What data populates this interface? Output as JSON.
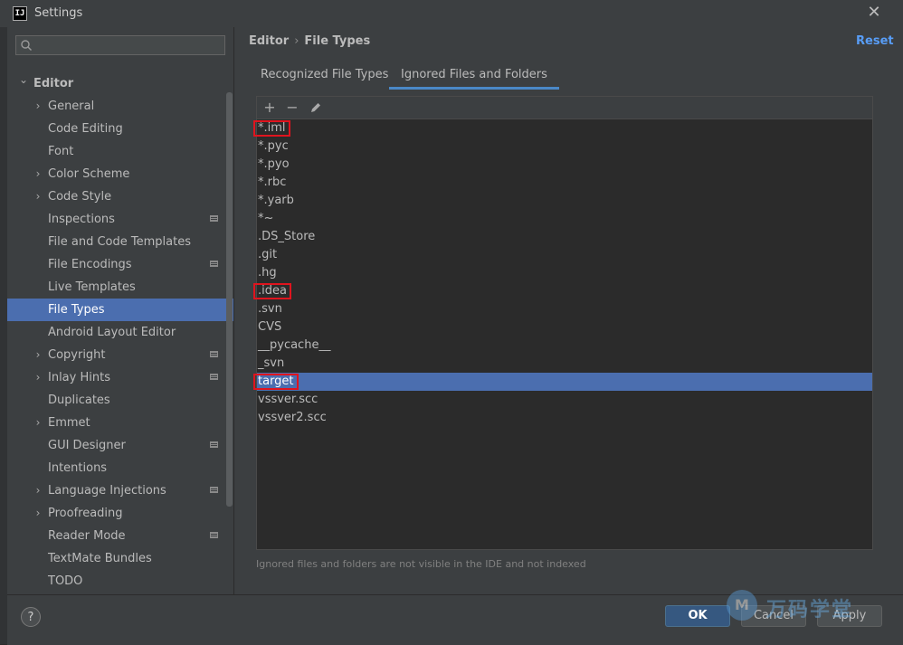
{
  "window": {
    "title": "Settings",
    "app_icon_text": "IJ"
  },
  "search": {
    "placeholder": ""
  },
  "sidebar": {
    "items": [
      {
        "label": "Editor",
        "level": 0,
        "expandable": true,
        "expanded": true,
        "selected": false,
        "badge": false
      },
      {
        "label": "General",
        "level": 1,
        "expandable": true,
        "selected": false,
        "badge": false
      },
      {
        "label": "Code Editing",
        "level": 1,
        "expandable": false,
        "selected": false,
        "badge": false
      },
      {
        "label": "Font",
        "level": 1,
        "expandable": false,
        "selected": false,
        "badge": false
      },
      {
        "label": "Color Scheme",
        "level": 1,
        "expandable": true,
        "selected": false,
        "badge": false
      },
      {
        "label": "Code Style",
        "level": 1,
        "expandable": true,
        "selected": false,
        "badge": false
      },
      {
        "label": "Inspections",
        "level": 1,
        "expandable": false,
        "selected": false,
        "badge": true
      },
      {
        "label": "File and Code Templates",
        "level": 1,
        "expandable": false,
        "selected": false,
        "badge": false
      },
      {
        "label": "File Encodings",
        "level": 1,
        "expandable": false,
        "selected": false,
        "badge": true
      },
      {
        "label": "Live Templates",
        "level": 1,
        "expandable": false,
        "selected": false,
        "badge": false
      },
      {
        "label": "File Types",
        "level": 1,
        "expandable": false,
        "selected": true,
        "badge": false
      },
      {
        "label": "Android Layout Editor",
        "level": 1,
        "expandable": false,
        "selected": false,
        "badge": false
      },
      {
        "label": "Copyright",
        "level": 1,
        "expandable": true,
        "selected": false,
        "badge": true
      },
      {
        "label": "Inlay Hints",
        "level": 1,
        "expandable": true,
        "selected": false,
        "badge": true
      },
      {
        "label": "Duplicates",
        "level": 1,
        "expandable": false,
        "selected": false,
        "badge": false
      },
      {
        "label": "Emmet",
        "level": 1,
        "expandable": true,
        "selected": false,
        "badge": false
      },
      {
        "label": "GUI Designer",
        "level": 1,
        "expandable": false,
        "selected": false,
        "badge": true
      },
      {
        "label": "Intentions",
        "level": 1,
        "expandable": false,
        "selected": false,
        "badge": false
      },
      {
        "label": "Language Injections",
        "level": 1,
        "expandable": true,
        "selected": false,
        "badge": true
      },
      {
        "label": "Proofreading",
        "level": 1,
        "expandable": true,
        "selected": false,
        "badge": false
      },
      {
        "label": "Reader Mode",
        "level": 1,
        "expandable": false,
        "selected": false,
        "badge": true
      },
      {
        "label": "TextMate Bundles",
        "level": 1,
        "expandable": false,
        "selected": false,
        "badge": false
      },
      {
        "label": "TODO",
        "level": 1,
        "expandable": false,
        "selected": false,
        "badge": false
      }
    ]
  },
  "breadcrumb": {
    "parent": "Editor",
    "separator": "›",
    "current": "File Types"
  },
  "header": {
    "reset_label": "Reset"
  },
  "tabs": [
    {
      "label": "Recognized File Types",
      "active": false
    },
    {
      "label": "Ignored Files and Folders",
      "active": true
    }
  ],
  "toolbar": {
    "add": "+",
    "remove": "−"
  },
  "ignored_list": [
    {
      "text": "*.iml",
      "selected": false,
      "highlighted": true
    },
    {
      "text": "*.pyc",
      "selected": false,
      "highlighted": false
    },
    {
      "text": "*.pyo",
      "selected": false,
      "highlighted": false
    },
    {
      "text": "*.rbc",
      "selected": false,
      "highlighted": false
    },
    {
      "text": "*.yarb",
      "selected": false,
      "highlighted": false
    },
    {
      "text": "*~",
      "selected": false,
      "highlighted": false
    },
    {
      "text": ".DS_Store",
      "selected": false,
      "highlighted": false
    },
    {
      "text": ".git",
      "selected": false,
      "highlighted": false
    },
    {
      "text": ".hg",
      "selected": false,
      "highlighted": false
    },
    {
      "text": ".idea",
      "selected": false,
      "highlighted": true
    },
    {
      "text": ".svn",
      "selected": false,
      "highlighted": false
    },
    {
      "text": "CVS",
      "selected": false,
      "highlighted": false
    },
    {
      "text": "__pycache__",
      "selected": false,
      "highlighted": false
    },
    {
      "text": "_svn",
      "selected": false,
      "highlighted": false
    },
    {
      "text": "target",
      "selected": true,
      "highlighted": true
    },
    {
      "text": "vssver.scc",
      "selected": false,
      "highlighted": false
    },
    {
      "text": "vssver2.scc",
      "selected": false,
      "highlighted": false
    }
  ],
  "note": "Ignored files and folders are not visible in the IDE and not indexed",
  "footer": {
    "help": "?",
    "ok": "OK",
    "cancel": "Cancel",
    "apply": "Apply"
  },
  "colors": {
    "selection": "#4b6eaf",
    "accent": "#589df6",
    "highlight_box": "#e0141e"
  }
}
